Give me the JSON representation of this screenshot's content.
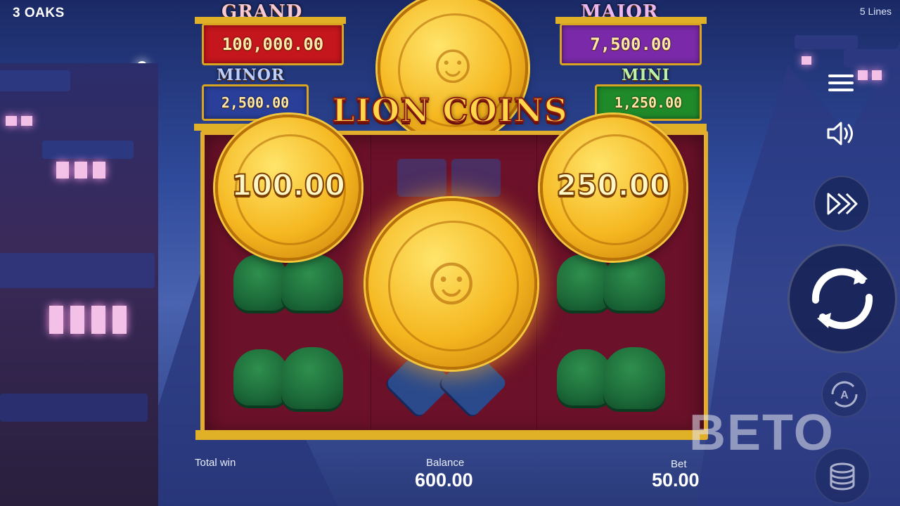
{
  "brand": "3 OAKS",
  "lines_label": "5 Lines",
  "jackpots": {
    "grand": {
      "label": "GRAND",
      "value": "100,000.00"
    },
    "major": {
      "label": "MAJOR",
      "value": "7,500.00"
    },
    "minor": {
      "label": "MINOR",
      "value": "2,500.00"
    },
    "mini": {
      "label": "MINI",
      "value": "1,250.00"
    }
  },
  "game_title": "LION COINS",
  "coins": {
    "left_value": "100.00",
    "right_value": "250.00"
  },
  "bottom": {
    "total_win_label": "Total win",
    "balance_label": "Balance",
    "balance_value": "600.00",
    "bet_label": "Bet",
    "bet_value": "50.00"
  },
  "watermark": "BETO",
  "colors": {
    "grand_box": "#c4161c",
    "major_box": "#7a2aa8",
    "minor_box": "#2a3f9a",
    "mini_box": "#1f8a2a",
    "reel_bg": "#6b1129",
    "gold": "#e2ae2b"
  },
  "icons": [
    "menu-icon",
    "sound-icon",
    "turbo-icon",
    "spin-icon",
    "autoplay-icon",
    "bet-chips-icon"
  ]
}
